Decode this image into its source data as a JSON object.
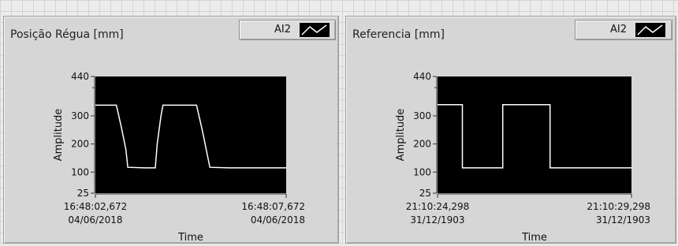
{
  "left_chart": {
    "title": "Posição Régua [mm]",
    "legend_label": "AI2",
    "legend_icon": "line-plot-icon",
    "chart_data": {
      "type": "line",
      "title": "Posição Régua [mm]",
      "xlabel": "Time",
      "ylabel": "Amplitude",
      "ylim": [
        25,
        440
      ],
      "xlim": [
        0,
        5
      ],
      "y_ticks": [
        "440",
        "300",
        "200",
        "100",
        "25"
      ],
      "x_tick_labels": [
        {
          "time": "16:48:02,672",
          "date": "04/06/2018"
        },
        {
          "time": "16:48:07,672",
          "date": "04/06/2018"
        }
      ],
      "series": [
        {
          "name": "AI2",
          "color": "#ffffff",
          "points": [
            [
              0,
              338
            ],
            [
              0.55,
              338
            ],
            [
              0.68,
              260
            ],
            [
              0.8,
              180
            ],
            [
              0.85,
              117
            ],
            [
              1.3,
              115
            ],
            [
              1.57,
              115
            ],
            [
              1.62,
              200
            ],
            [
              1.72,
              300
            ],
            [
              1.77,
              338
            ],
            [
              2.65,
              338
            ],
            [
              2.8,
              250
            ],
            [
              2.95,
              150
            ],
            [
              3.0,
              117
            ],
            [
              3.5,
              115
            ],
            [
              5.0,
              115
            ]
          ]
        }
      ]
    }
  },
  "right_chart": {
    "title": "Referencia [mm]",
    "legend_label": "AI2",
    "legend_icon": "line-plot-icon",
    "chart_data": {
      "type": "line",
      "title": "Referencia [mm]",
      "xlabel": "Time",
      "ylabel": "Amplitude",
      "ylim": [
        25,
        440
      ],
      "xlim": [
        0,
        5
      ],
      "y_ticks": [
        "440",
        "300",
        "200",
        "100",
        "25"
      ],
      "x_tick_labels": [
        {
          "time": "21:10:24,298",
          "date": "31/12/1903"
        },
        {
          "time": "21:10:29,298",
          "date": "31/12/1903"
        }
      ],
      "series": [
        {
          "name": "AI2",
          "color": "#ffffff",
          "points": [
            [
              0,
              340
            ],
            [
              0.64,
              340
            ],
            [
              0.64,
              115
            ],
            [
              1.68,
              115
            ],
            [
              1.68,
              340
            ],
            [
              2.9,
              340
            ],
            [
              2.9,
              115
            ],
            [
              5.0,
              115
            ]
          ]
        }
      ]
    }
  }
}
